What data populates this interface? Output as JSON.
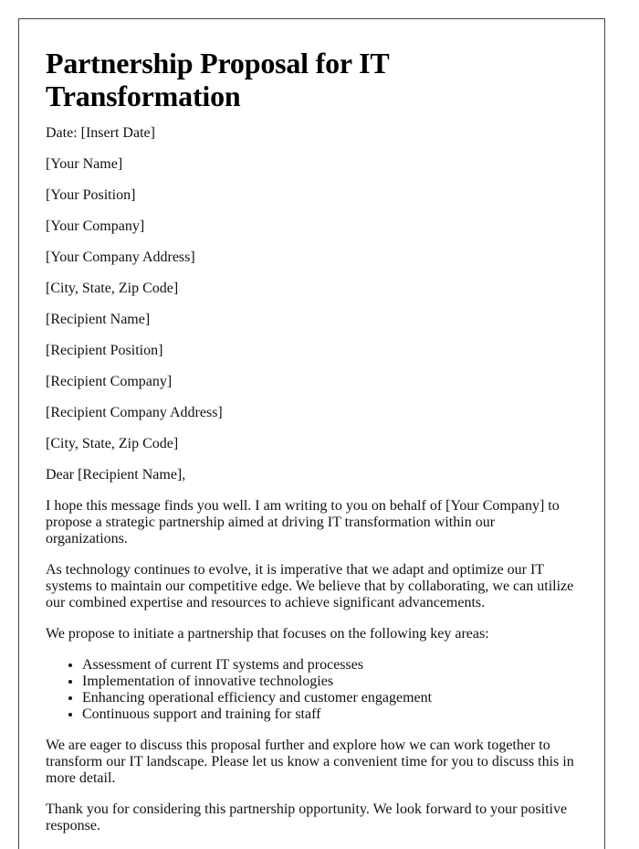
{
  "title": "Partnership Proposal for IT Transformation",
  "date_line": "Date: [Insert Date]",
  "sender": [
    "[Your Name]",
    "[Your Position]",
    "[Your Company]",
    "[Your Company Address]",
    "[City, State, Zip Code]"
  ],
  "recipient": [
    "[Recipient Name]",
    "[Recipient Position]",
    "[Recipient Company]",
    "[Recipient Company Address]",
    "[City, State, Zip Code]"
  ],
  "salutation": "Dear [Recipient Name],",
  "paragraphs": [
    "I hope this message finds you well. I am writing to you on behalf of [Your Company] to propose a strategic partnership aimed at driving IT transformation within our organizations.",
    "As technology continues to evolve, it is imperative that we adapt and optimize our IT systems to maintain our competitive edge. We believe that by collaborating, we can utilize our combined expertise and resources to achieve significant advancements.",
    "We propose to initiate a partnership that focuses on the following key areas:"
  ],
  "key_areas": [
    "Assessment of current IT systems and processes",
    "Implementation of innovative technologies",
    "Enhancing operational efficiency and customer engagement",
    "Continuous support and training for staff"
  ],
  "closing_paragraphs": [
    "We are eager to discuss this proposal further and explore how we can work together to transform our IT landscape. Please let us know a convenient time for you to discuss this in more detail.",
    "Thank you for considering this partnership opportunity. We look forward to your positive response."
  ]
}
